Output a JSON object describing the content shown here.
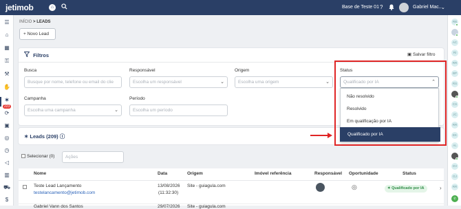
{
  "topbar": {
    "logo": "jetimob",
    "base": "Base de Teste 01",
    "user": "Gabriel Mac..."
  },
  "sidebar": {
    "badge": "223",
    "icons": [
      "home-icon",
      "building-icon",
      "search-icon",
      "tools-icon",
      "share-icon",
      "refresh-icon",
      "calendar-icon",
      "target-icon",
      "clock-icon",
      "megaphone-icon",
      "book-icon",
      "cart-icon",
      "money-icon",
      "grid-icon"
    ]
  },
  "right_sidebar": {
    "avatars": [
      "RB",
      "",
      "AC",
      "RI",
      "RR",
      "BP",
      "RS",
      "CS",
      "JC",
      "RR",
      "EK",
      "AL",
      "GV",
      "GJ",
      "RR"
    ]
  },
  "breadcrumb": {
    "home": "INÍCIO",
    "sep": ">",
    "current": "LEADS"
  },
  "new_lead": {
    "label": "+ Novo Lead"
  },
  "filters": {
    "title": "Filtros",
    "save": "Salvar filtro",
    "busca": {
      "label": "Busca",
      "placeholder": "Busque por nome, telefone ou email do clie"
    },
    "responsavel": {
      "label": "Responsável",
      "placeholder": "Escolha um responsável"
    },
    "origem": {
      "label": "Origem",
      "placeholder": "Escolha uma origem"
    },
    "status": {
      "label": "Status",
      "placeholder": "Qualificado por IA"
    },
    "campanha": {
      "label": "Campanha",
      "placeholder": "Escolha uma campanha"
    },
    "periodo": {
      "label": "Período",
      "placeholder": "Escolha um período"
    }
  },
  "status_dropdown": {
    "options": [
      "Não resolvido",
      "Resolvido",
      "Em qualificação por IA"
    ],
    "selected": "Qualificado por IA"
  },
  "leads": {
    "title": "Leads (209)"
  },
  "toolbar": {
    "select_all": "Selecionar (0)",
    "actions": "Ações"
  },
  "table": {
    "headers": {
      "nome": "Nome",
      "data": "Data",
      "origem": "Origem",
      "imovel": "Imóvel referência",
      "responsavel": "Responsável",
      "oportunidade": "Oportunidade",
      "status": "Status"
    },
    "rows": [
      {
        "name": "Teste Lead Lançamento",
        "email": "testelancamento@jetimob.com",
        "date": "13/08/2026",
        "time": "(11:32:30)",
        "origin": "Site - guiagula.com",
        "status": "Qualificado por IA"
      },
      {
        "name": "Gabriel Vann dos Santos",
        "date": "29/07/2026",
        "origin": "Site - guiagula.com"
      }
    ]
  },
  "colors": {
    "primary": "#2a3f66",
    "highlight": "#e02424",
    "status_green": "#2e8b46"
  }
}
